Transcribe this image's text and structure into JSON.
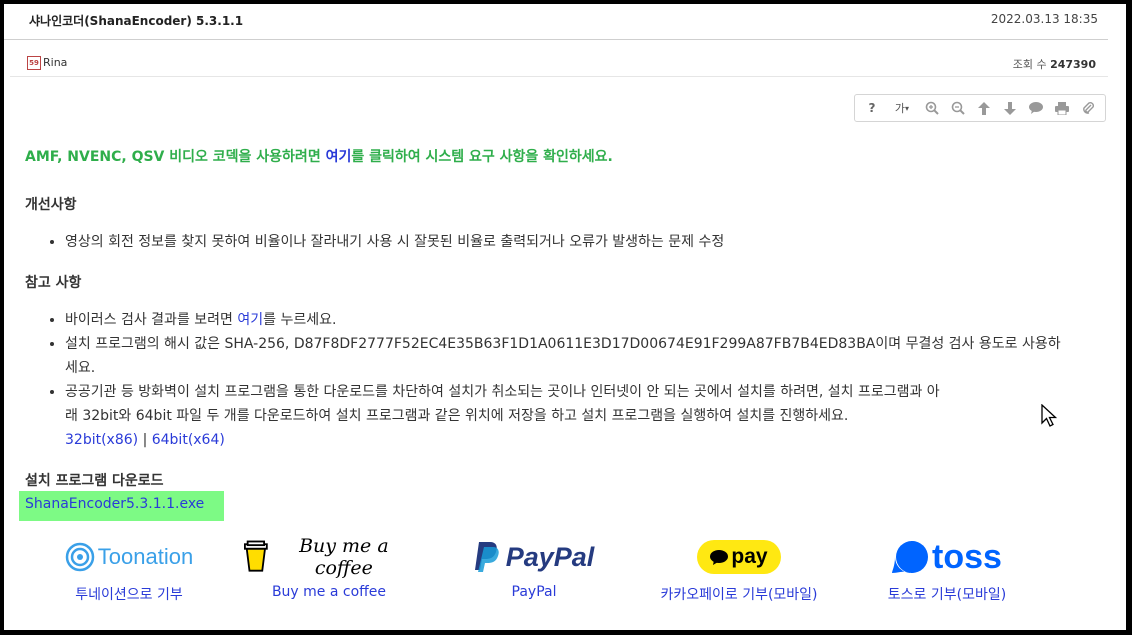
{
  "post": {
    "title": "샤나인코더(ShanaEncoder) 5.3.1.1",
    "date": "2022.03.13 18:35",
    "author": "Rina",
    "avatar_text": "59",
    "views_label": "조회 수",
    "views_value": "247390"
  },
  "toolbar": {
    "font_label": "가"
  },
  "notice": {
    "before": "AMF, NVENC, QSV 비디오 코덱을 사용하려면 ",
    "link": "여기",
    "after": "를 클릭하여 시스템 요구 사항을 확인하세요."
  },
  "improvements": {
    "heading": "개선사항",
    "items": [
      "영상의 회전 정보를 찾지 못하여 비율이나 잘라내기 사용 시 잘못된 비율로 출력되거나 오류가 발생하는 문제 수정"
    ]
  },
  "notes": {
    "heading": "참고 사항",
    "item1_before": "바이러스 검사 결과를 보려면 ",
    "item1_link": "여기",
    "item1_after": "를 누르세요.",
    "item2_line1": "설치 프로그램의 해시 값은 SHA-256, D87F8DF2777F52EC4E35B63F1D1A0611E3D17D00674E91F299A87FB7B4ED83BA이며 무결성 검사 용도로 사용하",
    "item2_line2": "세요.",
    "item3_line1": "공공기관 등 방화벽이 설치 프로그램을 통한 다운로드를 차단하여 설치가 취소되는 곳이나 인터넷이 안 되는 곳에서 설치를 하려면, 설치 프로그램과 아",
    "item3_line2": "래 32bit와 64bit 파일 두 개를 다운로드하여 설치 프로그램과 같은 위치에 저장을 하고 설치 프로그램을 실행하여 설치를 진행하세요.",
    "link_32": "32bit(x86)",
    "separator": "|",
    "link_64": "64bit(x64)"
  },
  "download": {
    "heading": "설치 프로그램 다운로드",
    "file": "ShanaEncoder5.3.1.1.exe"
  },
  "donations": [
    {
      "logo": "Toonation",
      "label": "투네이션으로 기부"
    },
    {
      "logo": "Buy me a coffee",
      "label": "Buy me a coffee"
    },
    {
      "logo": "PayPal",
      "label": "PayPal"
    },
    {
      "logo": "pay",
      "label": "카카오페이로 기부(모바일)"
    },
    {
      "logo": "toss",
      "label": "토스로 기부(모바일)"
    }
  ],
  "colors": {
    "notice_green": "#2fae4b",
    "link_blue": "#2a3bd8",
    "download_highlight": "#7dfa85",
    "toonation": "#3aa0e8",
    "paypal_dark": "#253b80",
    "paypal_light": "#179bd7",
    "kakao_yellow": "#ffe812",
    "toss_blue": "#0064ff"
  }
}
